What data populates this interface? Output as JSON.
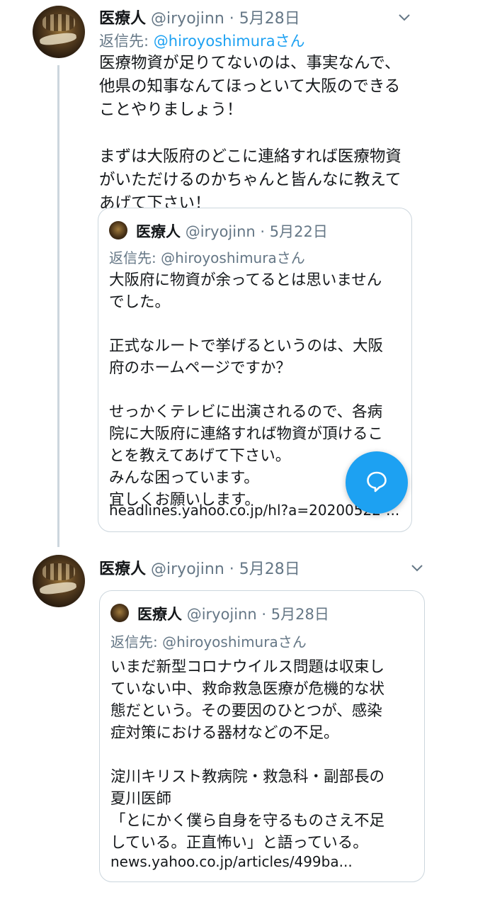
{
  "tweets": [
    {
      "name": "医療人",
      "handle": "@iryojinn",
      "date": "· 5月28日",
      "reply_prefix": "返信先: ",
      "reply_to": "@hiroyoshimuraさん",
      "text": "医療物資が足りてないのは、事実なんで、\n他県の知事なんてほっといて大阪のできる\nことやりましょう！\n\nまずは大阪府のどこに連絡すれば医療物資\nがいただけるのかちゃんと皆んなに教えて\nあげて下さい！",
      "quote": {
        "name": "医療人",
        "handle": "@iryojinn",
        "date": "· 5月22日",
        "reply": "返信先: @hiroyoshimuraさん",
        "text": "大阪府に物資が余ってるとは思いません\nでした。\n\n正式なルートで挙げるというのは、大阪\n府のホームページですか？\n\nせっかくテレビに出演されるので、各病\n院に大阪府に連絡すれば物資が頂けるこ\nとを教えてあげて下さい。\nみんな困っています。\n宜しくお願いします。",
        "link": "headlines.yahoo.co.jp/hl?a=20200522-..."
      }
    },
    {
      "name": "医療人",
      "handle": "@iryojinn",
      "date": "· 5月28日",
      "quote": {
        "name": "医療人",
        "handle": "@iryojinn",
        "date": "· 5月28日",
        "reply": "返信先: @hiroyoshimuraさん",
        "text": "いまだ新型コロナウイルス問題は収束し\nていない中、救命救急医療が危機的な状\n態だという。その要因のひとつが、感染\n症対策における器材などの不足。\n\n淀川キリスト教病院・救急科・副部長の\n夏川医師\n「とにかく僕ら自身を守るものさえ不足\nしている。正直怖い」と語っている。",
        "link": "news.yahoo.co.jp/articles/499ba..."
      }
    }
  ],
  "icons": {
    "caret": "chevron-down-icon",
    "fab": "compose-reply-icon"
  },
  "colors": {
    "accent": "#1da1f2",
    "secondary_text": "#657786",
    "border": "#ccd6dd"
  }
}
